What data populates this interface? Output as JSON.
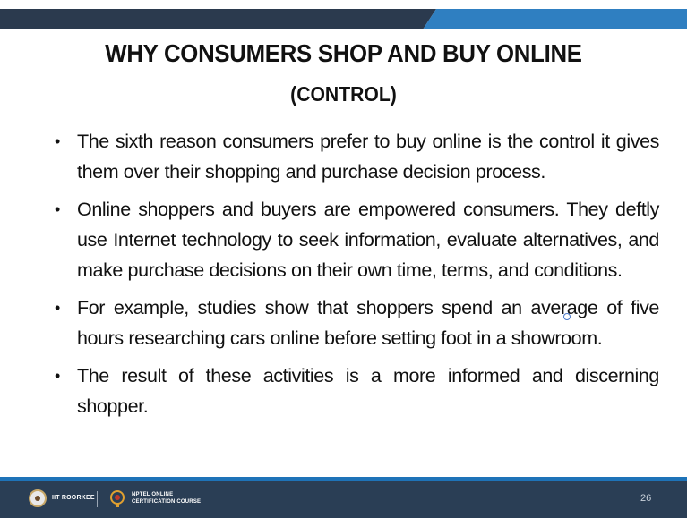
{
  "slide": {
    "title": "WHY CONSUMERS SHOP AND BUY ONLINE",
    "subtitle": "(CONTROL)",
    "bullets": [
      "The sixth reason consumers prefer to buy online is the control it gives them over their shopping and purchase decision process.",
      "Online shoppers and buyers are empowered consumers. They deftly use Internet technology to seek information, evaluate alternatives, and make purchase decisions on their own time, terms, and conditions.",
      "For example, studies show that shoppers spend an average of five hours researching cars online before setting foot in a showroom.",
      "The result of these activities is a more informed and discerning shopper."
    ],
    "bullet_glyph": "•"
  },
  "footer": {
    "institute_label": "IIT ROORKEE",
    "course_label_line1": "NPTEL ONLINE",
    "course_label_line2": "CERTIFICATION COURSE",
    "page_number": "26"
  },
  "colors": {
    "top_bar_dark": "#2b3a4e",
    "top_bar_accent": "#2f7fc1",
    "footer_bg": "#2a3e55",
    "footer_line": "#1e73b8"
  },
  "icons": {
    "institute_logo": "iit-roorkee-logo-icon",
    "course_logo": "nptel-logo-icon"
  }
}
